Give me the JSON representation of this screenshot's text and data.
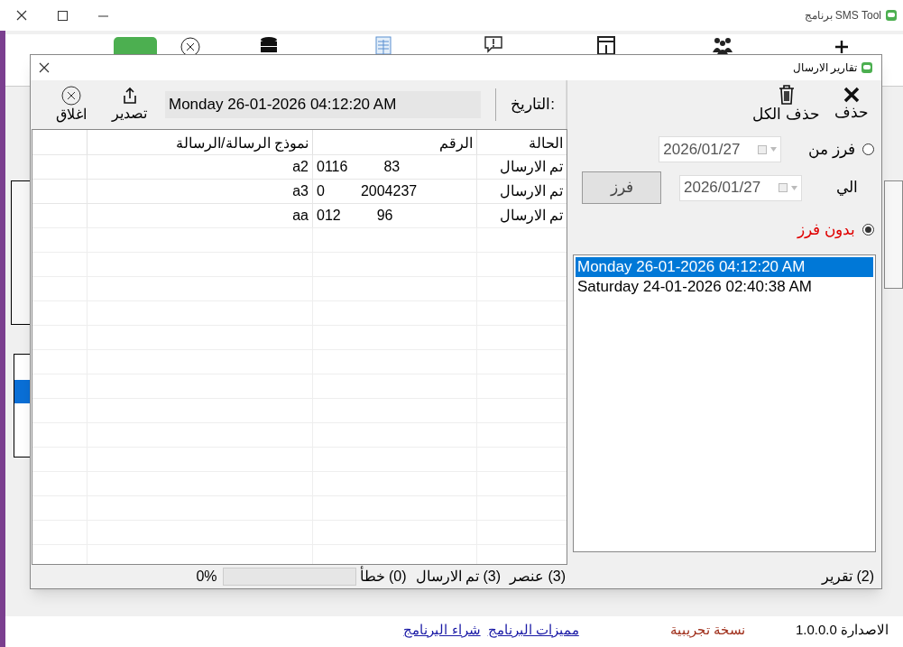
{
  "window": {
    "title": "برنامج SMS Tool"
  },
  "version": {
    "label": "الاصدارة",
    "value": "1.0.0.0"
  },
  "edition": "نسخة تجريبية",
  "links": [
    "مميزات البرنامج",
    "شراء البرنامج"
  ],
  "dialog": {
    "title": "تقارير الارسال",
    "toolbar": {
      "delete": "حذف",
      "delete_all": "حذف الكل",
      "date_label": "التاريخ:",
      "date_value": "Monday 26-01-2026 04:12:20 AM",
      "export": "تصدير",
      "close": "اغلاق"
    },
    "filter": {
      "options": [
        {
          "label": "فرز من",
          "selected": false
        },
        {
          "label": "بدون فرز",
          "selected": true
        }
      ],
      "from": "2026/01/27",
      "to_label": "الي",
      "to": "2026/01/27",
      "button": "فرز"
    },
    "reports": [
      {
        "label": "Monday 26-01-2026 04:12:20 AM",
        "selected": true
      },
      {
        "label": "Saturday 24-01-2026 02:40:38 AM",
        "selected": false
      }
    ],
    "table": {
      "columns": [
        "الحالة",
        "الرقم",
        "نموذج الرسالة/الرسالة"
      ],
      "rows": [
        {
          "status": "تم الارسال",
          "number_start": "0116",
          "number_end": "83",
          "message": "a2"
        },
        {
          "status": "تم الارسال",
          "number_start": "0",
          "number_end": "2004237",
          "message": "a3"
        },
        {
          "status": "تم الارسال",
          "number_start": "012",
          "number_end": "96",
          "message": "aa"
        }
      ]
    },
    "status": {
      "reports": "(2) تقرير",
      "items": "(3) عنصر",
      "sent": "(3) تم الارسال",
      "errors": "(0) خطأ",
      "level": 0,
      "percent": "0%"
    }
  }
}
